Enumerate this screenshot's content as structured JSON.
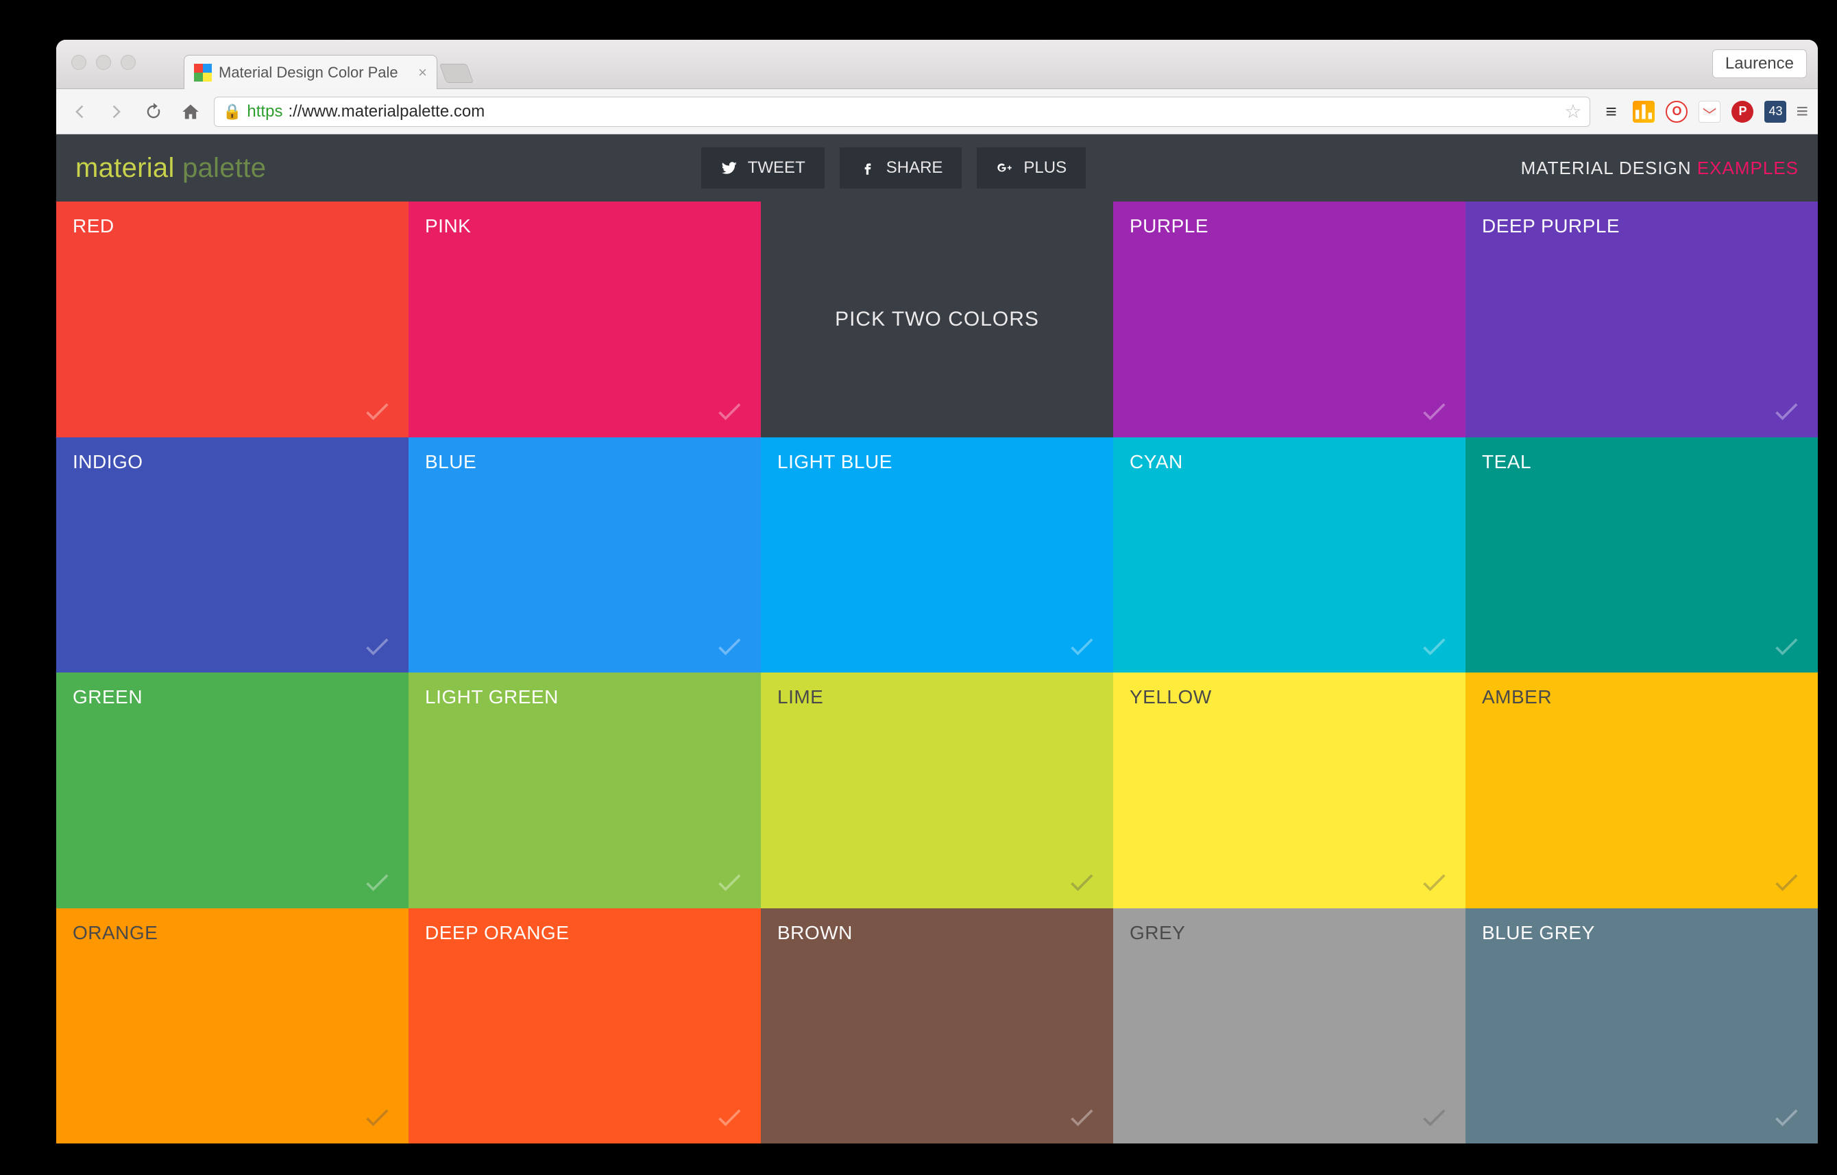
{
  "window": {
    "tab_title": "Material Design Color Pale",
    "user": "Laurence"
  },
  "address": {
    "url_scheme": "https",
    "url_rest": "://www.materialpalette.com",
    "ext_number": "43"
  },
  "header": {
    "logo_a": "material ",
    "logo_b": "palette",
    "tweet": "TWEET",
    "share": "SHARE",
    "plus": "PLUS",
    "right_a": "MATERIAL DESIGN ",
    "right_b": "EXAMPLES"
  },
  "placeholder_msg": "PICK TWO COLORS",
  "swatches": [
    {
      "name": "RED",
      "hex": "#f44336",
      "dark": false
    },
    {
      "name": "PINK",
      "hex": "#e91e63",
      "dark": false
    },
    {
      "name": "__placeholder__"
    },
    {
      "name": "PURPLE",
      "hex": "#9c27b0",
      "dark": false
    },
    {
      "name": "DEEP PURPLE",
      "hex": "#673ab7",
      "dark": false
    },
    {
      "name": "INDIGO",
      "hex": "#3f51b5",
      "dark": false
    },
    {
      "name": "BLUE",
      "hex": "#2196f3",
      "dark": false
    },
    {
      "name": "LIGHT BLUE",
      "hex": "#03a9f4",
      "dark": false
    },
    {
      "name": "CYAN",
      "hex": "#00bcd4",
      "dark": false
    },
    {
      "name": "TEAL",
      "hex": "#009688",
      "dark": false
    },
    {
      "name": "GREEN",
      "hex": "#4caf50",
      "dark": false
    },
    {
      "name": "LIGHT GREEN",
      "hex": "#8bc34a",
      "dark": false
    },
    {
      "name": "LIME",
      "hex": "#cddc39",
      "dark": true
    },
    {
      "name": "YELLOW",
      "hex": "#ffeb3b",
      "dark": true
    },
    {
      "name": "AMBER",
      "hex": "#ffc107",
      "dark": true
    },
    {
      "name": "ORANGE",
      "hex": "#ff9800",
      "dark": true
    },
    {
      "name": "DEEP ORANGE",
      "hex": "#ff5722",
      "dark": false
    },
    {
      "name": "BROWN",
      "hex": "#795548",
      "dark": false
    },
    {
      "name": "GREY",
      "hex": "#9e9e9e",
      "dark": true
    },
    {
      "name": "BLUE GREY",
      "hex": "#607d8b",
      "dark": false
    }
  ]
}
